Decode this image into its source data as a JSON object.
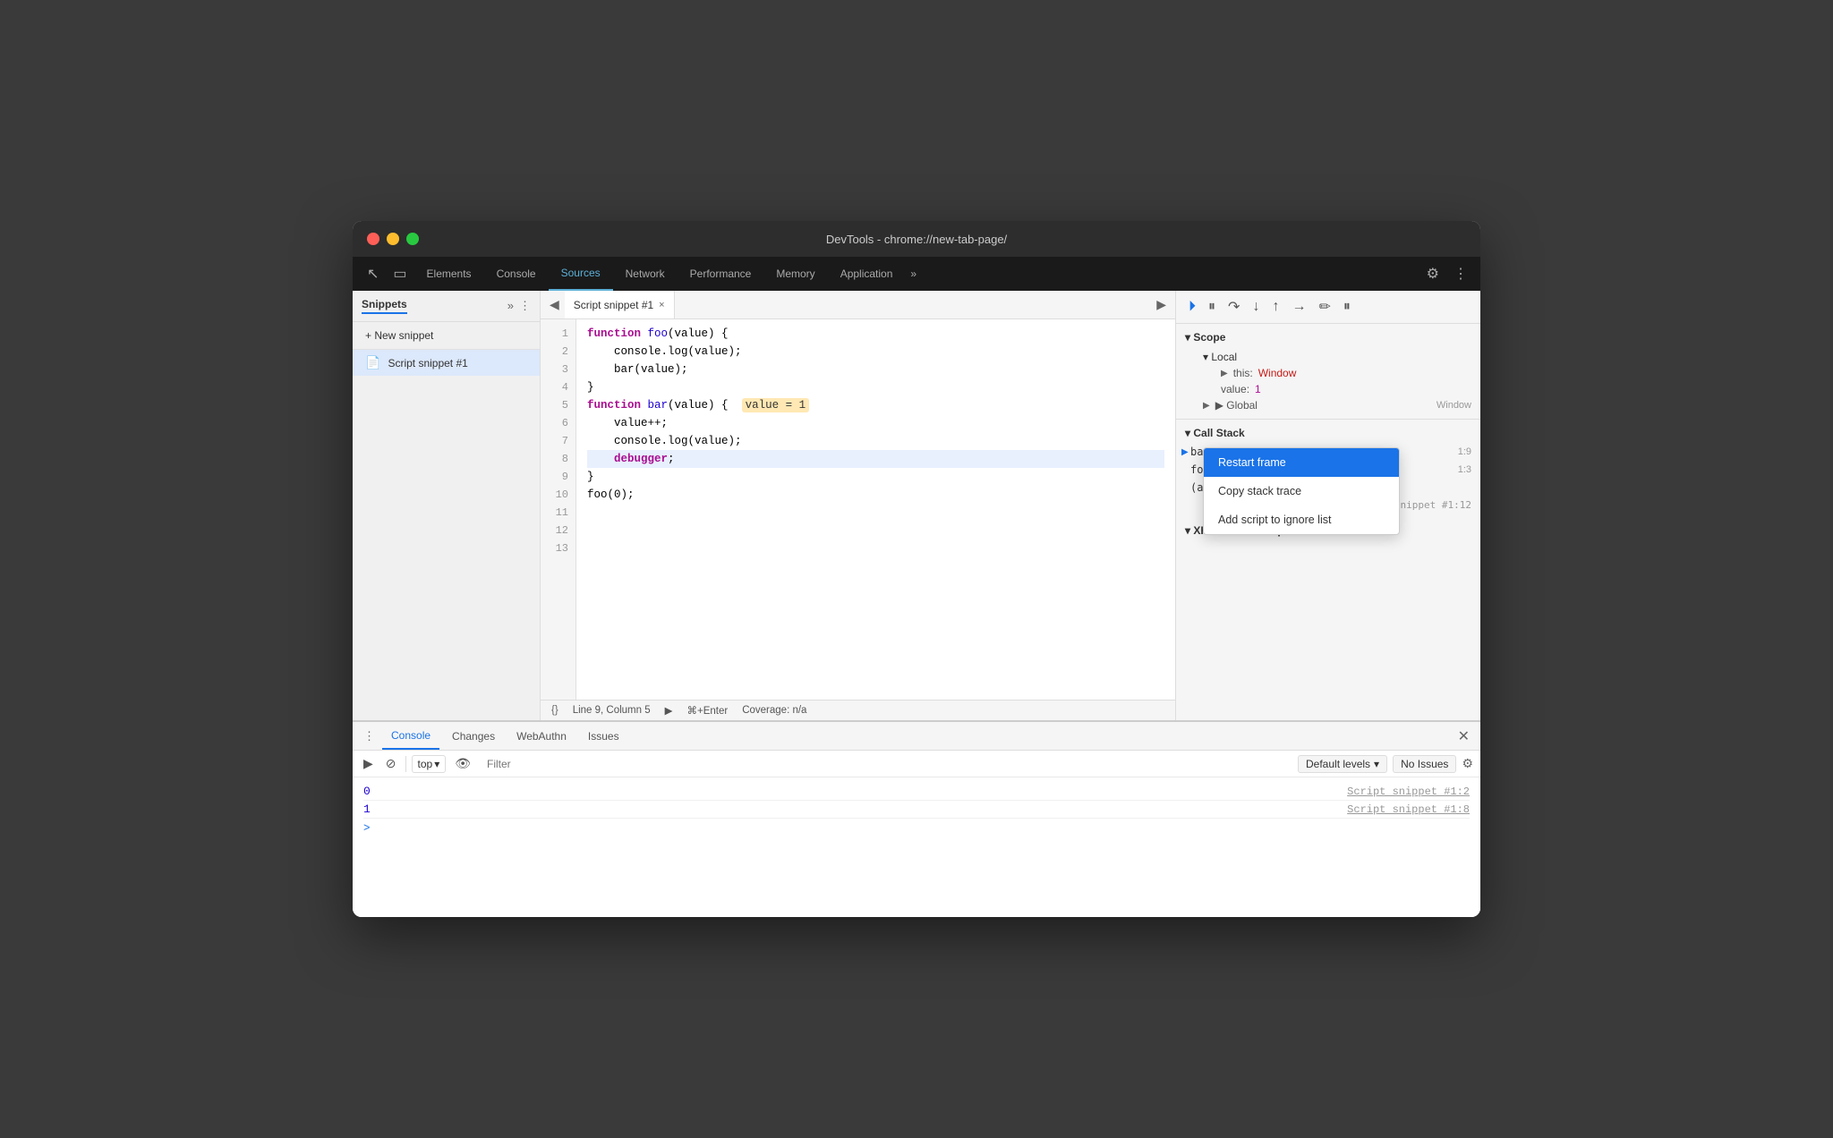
{
  "window": {
    "title": "DevTools - chrome://new-tab-page/"
  },
  "titlebar_buttons": {
    "close": "×",
    "min": "–",
    "max": "+"
  },
  "devtools_tabs": {
    "items": [
      {
        "id": "elements",
        "label": "Elements",
        "active": false
      },
      {
        "id": "console",
        "label": "Console",
        "active": false
      },
      {
        "id": "sources",
        "label": "Sources",
        "active": true
      },
      {
        "id": "network",
        "label": "Network",
        "active": false
      },
      {
        "id": "performance",
        "label": "Performance",
        "active": false
      },
      {
        "id": "memory",
        "label": "Memory",
        "active": false
      },
      {
        "id": "application",
        "label": "Application",
        "active": false
      }
    ],
    "more": "»"
  },
  "sidebar": {
    "title": "Snippets",
    "more_icon": "»",
    "menu_icon": "⋮",
    "new_snippet_label": "+ New snippet",
    "snippet_name": "Script snippet #1"
  },
  "editor": {
    "tab_name": "Script snippet #1",
    "tab_close": "×",
    "lines": [
      {
        "num": 1,
        "code": "function foo(value) {",
        "highlight": false
      },
      {
        "num": 2,
        "code": "    console.log(value);",
        "highlight": false
      },
      {
        "num": 3,
        "code": "    bar(value);",
        "highlight": false
      },
      {
        "num": 4,
        "code": "}",
        "highlight": false
      },
      {
        "num": 5,
        "code": "",
        "highlight": false
      },
      {
        "num": 6,
        "code": "function bar(value) {",
        "highlight": false,
        "has_val": true,
        "val_text": "value = 1"
      },
      {
        "num": 7,
        "code": "    value++;",
        "highlight": false
      },
      {
        "num": 8,
        "code": "    console.log(value);",
        "highlight": false
      },
      {
        "num": 9,
        "code": "    debugger;",
        "highlight": true
      },
      {
        "num": 10,
        "code": "}",
        "highlight": false
      },
      {
        "num": 11,
        "code": "",
        "highlight": false
      },
      {
        "num": 12,
        "code": "foo(0);",
        "highlight": false
      },
      {
        "num": 13,
        "code": "",
        "highlight": false
      }
    ],
    "status_bar": {
      "format_icon": "{}",
      "position": "Line 9, Column 5",
      "run_icon": "▶",
      "run_shortcut": "⌘+Enter",
      "coverage": "Coverage: n/a"
    }
  },
  "right_panel": {
    "scope_label": "▾ Scope",
    "local_label": "▾ Local",
    "this_label": "▶ this:",
    "this_val": "Window",
    "value_label": "value:",
    "value_val": "1",
    "global_label": "▶ Global",
    "global_val": "Window",
    "call_stack_label": "▾ Call Stack",
    "stack_frames": [
      {
        "name": "bar",
        "loc": "1:9",
        "active": true
      },
      {
        "name": "foo",
        "loc": "1:3",
        "active": false
      },
      {
        "name": "(anonymous)",
        "loc": "",
        "active": false
      }
    ],
    "snippet_loc": "Script snippet #1:12",
    "xhrlabel": "▾ XHR/fetch Breakpoints"
  },
  "context_menu": {
    "items": [
      {
        "id": "restart-frame",
        "label": "Restart frame",
        "selected": true
      },
      {
        "id": "copy-stack-trace",
        "label": "Copy stack trace",
        "selected": false
      },
      {
        "id": "add-to-ignore",
        "label": "Add script to ignore list",
        "selected": false
      }
    ]
  },
  "console_panel": {
    "tabs": [
      {
        "id": "console",
        "label": "Console",
        "active": true
      },
      {
        "id": "changes",
        "label": "Changes",
        "active": false
      },
      {
        "id": "webauthn",
        "label": "WebAuthn",
        "active": false
      },
      {
        "id": "issues",
        "label": "Issues",
        "active": false
      }
    ],
    "toolbar": {
      "top_label": "top",
      "filter_placeholder": "Filter",
      "levels_label": "Default levels",
      "issues_label": "No Issues"
    },
    "log_lines": [
      {
        "value": "0",
        "source": "Script snippet #1:2"
      },
      {
        "value": "1",
        "source": "Script snippet #1:8"
      }
    ],
    "prompt": ">"
  }
}
